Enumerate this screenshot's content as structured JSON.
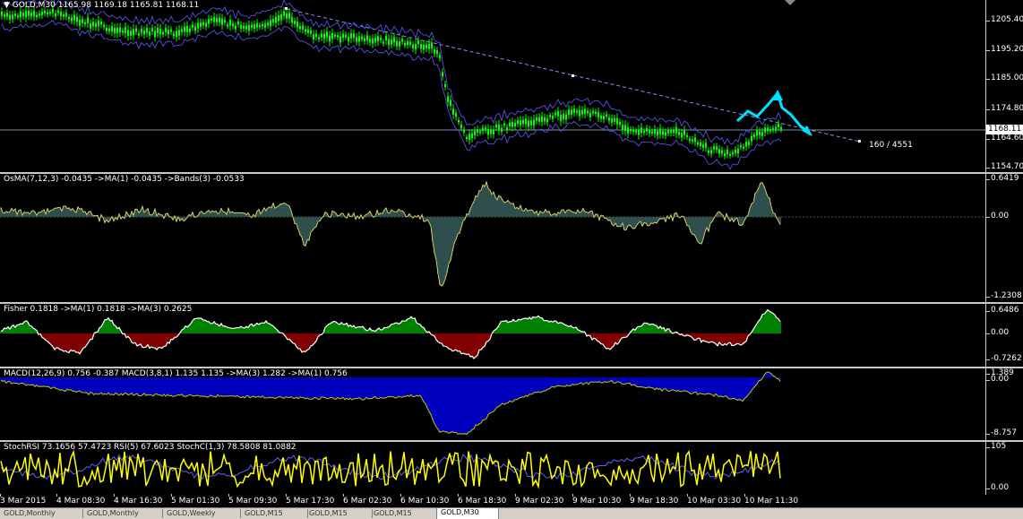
{
  "main": {
    "title": "▼ GOLD,M30  1165.98 1169.18 1165.81 1168.11",
    "price_scale": [
      "1205.40",
      "1195.20",
      "1185.00",
      "1174.80",
      "1164.60",
      "1154.70"
    ],
    "current_price": "1168.11",
    "counter": "160 / 4551"
  },
  "osma": {
    "title": "OsMA(7,12,3) -0.0435  ->MA(1) -0.0435  ->Bands(3) -0.0533",
    "scale": [
      "0.6419",
      "0.00",
      "-1.2308"
    ]
  },
  "fisher": {
    "title": "Fisher 0.1818  ->MA(1) 0.1818  ->MA(3) 0.2625",
    "scale": [
      "0.6486",
      "0.00",
      "-0.7262"
    ]
  },
  "macd": {
    "title": "MACD(12,26,9) 0.756 -0.387  MACD(3,8,1) 1.135 1.135  ->MA(3) 1.282  ->MA(1) 0.756",
    "scale": [
      "1.389",
      "0.00",
      "-8.757"
    ]
  },
  "stoch": {
    "title": "StochRSI 73.1656 57.4723  RSI(5) 67.6023  StochC(1,3) 78.5808 81.0882",
    "scale": [
      "105",
      "0.00"
    ]
  },
  "time_axis": [
    "3 Mar 2015",
    "4 Mar 08:30",
    "4 Mar 16:30",
    "5 Mar 01:30",
    "5 Mar 09:30",
    "5 Mar 17:30",
    "6 Mar 02:30",
    "6 Mar 10:30",
    "6 Mar 18:30",
    "9 Mar 02:30",
    "9 Mar 10:30",
    "9 Mar 18:30",
    "10 Mar 03:30",
    "10 Mar 11:30"
  ],
  "tabs": [
    "GOLD,Monthly",
    "GOLD,Monthly",
    "GOLD,Weekly",
    "GOLD,M15",
    "GOLD,M15",
    "GOLD,M15",
    "GOLD,M30"
  ],
  "active_tab": 6,
  "colors": {
    "candles": "#00ff00",
    "trendline": "#8c8cff",
    "arrow": "#00e0ff",
    "osma_fill": "#2f4f4f",
    "fisher_up": "#00ff00",
    "fisher_down": "#ff0000",
    "macd_hist": "#0000ff",
    "stoch_main": "#ffff00"
  }
}
